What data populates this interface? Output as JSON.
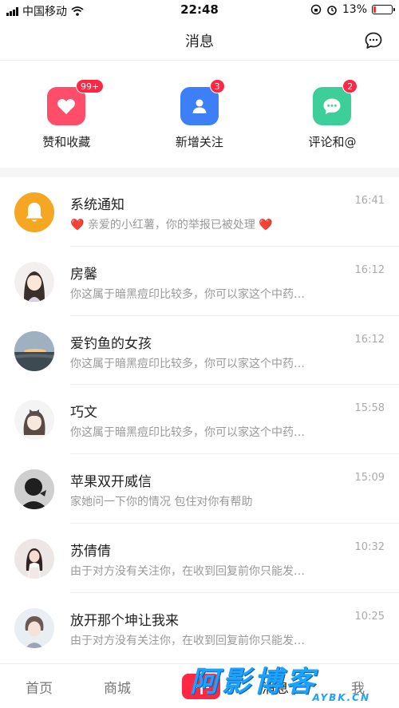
{
  "status_bar": {
    "carrier": "中国移动",
    "time": "22:48",
    "battery": "13%",
    "battery_level": 0.13
  },
  "header": {
    "title": "消息",
    "chat_icon": "chat-bubble-icon"
  },
  "quick_actions": [
    {
      "label": "赞和收藏",
      "badge": "99+",
      "icon": "heart-icon",
      "color": "#ff4d6a"
    },
    {
      "label": "新增关注",
      "badge": "3",
      "icon": "person-icon",
      "color": "#3d7ff6"
    },
    {
      "label": "评论和@",
      "badge": "2",
      "icon": "comment-icon",
      "color": "#3ccf9a"
    }
  ],
  "messages": [
    {
      "name": "系统通知",
      "preview": "❤️ 亲爱的小红薯，你的举报已被处理 ❤️",
      "time": "16:41",
      "avatar": "bell-icon"
    },
    {
      "name": "房馨",
      "preview": "你这属于暗黑痘印比较多，你可以家这个中药…",
      "time": "16:12",
      "avatar": "user-avatar"
    },
    {
      "name": "爱钓鱼的女孩",
      "preview": "你这属于暗黑痘印比较多，你可以家这个中药…",
      "time": "16:12",
      "avatar": "user-avatar"
    },
    {
      "name": "巧文",
      "preview": "你这属于暗黑痘印比较多，你可以家这个中药…",
      "time": "15:58",
      "avatar": "user-avatar"
    },
    {
      "name": "苹果双开威信",
      "preview": "家她问一下你的情况 包住对你有帮助",
      "time": "15:09",
      "avatar": "user-avatar"
    },
    {
      "name": "苏倩倩",
      "preview": "由于对方没有关注你，在收到回复前你只能发…",
      "time": "10:32",
      "avatar": "user-avatar"
    },
    {
      "name": "放开那个坤让我来",
      "preview": "由于对方没有关注你，在收到回复前你只能发…",
      "time": "10:25",
      "avatar": "user-avatar"
    }
  ],
  "tabbar": {
    "home": "首页",
    "mall": "商城",
    "messages": "消息",
    "me": "我"
  },
  "watermark": {
    "big": "阿影博客",
    "small": "AYBK.CN"
  }
}
